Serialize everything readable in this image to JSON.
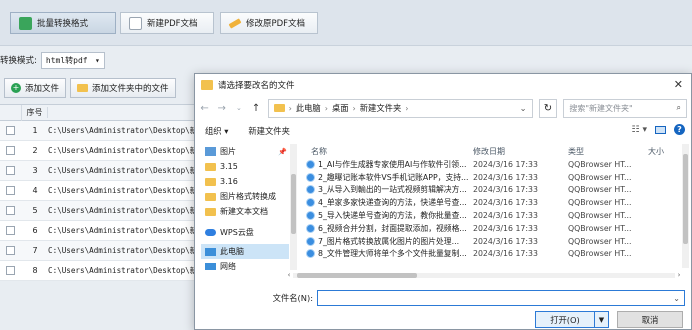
{
  "toolbar": {
    "batch_convert": "批量转换格式",
    "new_pdf": "新建PDF文档",
    "edit_pdf": "修改原PDF文档"
  },
  "mode": {
    "label": "转换模式:",
    "value": "html转pdf"
  },
  "add": {
    "add_files": "添加文件",
    "add_folder_files": "添加文件夹中的文件"
  },
  "table": {
    "header_no": "序号",
    "rows": [
      {
        "no": "1",
        "path": "C:\\Users\\Administrator\\Desktop\\新"
      },
      {
        "no": "2",
        "path": "C:\\Users\\Administrator\\Desktop\\新"
      },
      {
        "no": "3",
        "path": "C:\\Users\\Administrator\\Desktop\\新"
      },
      {
        "no": "4",
        "path": "C:\\Users\\Administrator\\Desktop\\新"
      },
      {
        "no": "5",
        "path": "C:\\Users\\Administrator\\Desktop\\新"
      },
      {
        "no": "6",
        "path": "C:\\Users\\Administrator\\Desktop\\新"
      },
      {
        "no": "7",
        "path": "C:\\Users\\Administrator\\Desktop\\新"
      },
      {
        "no": "8",
        "path": "C:\\Users\\Administrator\\Desktop\\新"
      }
    ]
  },
  "dialog": {
    "title": "请选择要改名的文件",
    "address": {
      "pc": "此电脑",
      "desktop": "桌面",
      "folder": "新建文件夹"
    },
    "search_placeholder": "搜索\"新建文件夹\"",
    "organize": "组织 ▾",
    "new_folder": "新建文件夹",
    "nav_items": [
      {
        "label": "图片"
      },
      {
        "label": "3.15"
      },
      {
        "label": "3.16"
      },
      {
        "label": "图片格式转换成"
      },
      {
        "label": "新建文本文档"
      },
      {
        "label": "WPS云盘"
      },
      {
        "label": "此电脑"
      },
      {
        "label": "网络"
      }
    ],
    "columns": {
      "name": "名称",
      "date": "修改日期",
      "type": "类型",
      "size": "大小"
    },
    "files": [
      {
        "name": "1_AI与作生成器专家使用AI与作软件引领...",
        "date": "2024/3/16 17:33",
        "type": "QQBrowser HT..."
      },
      {
        "name": "2_趣曝记账本软件VS手机记账APP，支持...",
        "date": "2024/3/16 17:33",
        "type": "QQBrowser HT..."
      },
      {
        "name": "3_从导入到輸出的一站式视频剪辑解决方...",
        "date": "2024/3/16 17:33",
        "type": "QQBrowser HT..."
      },
      {
        "name": "4_单家多家快递查询的方法，快递单号查...",
        "date": "2024/3/16 17:33",
        "type": "QQBrowser HT..."
      },
      {
        "name": "5_导入快递单号查询的方法，教你批量查...",
        "date": "2024/3/16 17:33",
        "type": "QQBrowser HT..."
      },
      {
        "name": "6_视频合并分割，封面提取添加，视频格...",
        "date": "2024/3/16 17:33",
        "type": "QQBrowser HT..."
      },
      {
        "name": "7_图片格式转换放属化图片的图片处理...",
        "date": "2024/3/16 17:33",
        "type": "QQBrowser HT..."
      },
      {
        "name": "8_文件管理大师将单个多个文件批量复制...",
        "date": "2024/3/16 17:33",
        "type": "QQBrowser HT..."
      }
    ],
    "filename_label": "文件名(N):",
    "open_button": "打开(O)",
    "cancel_button": "取消"
  }
}
